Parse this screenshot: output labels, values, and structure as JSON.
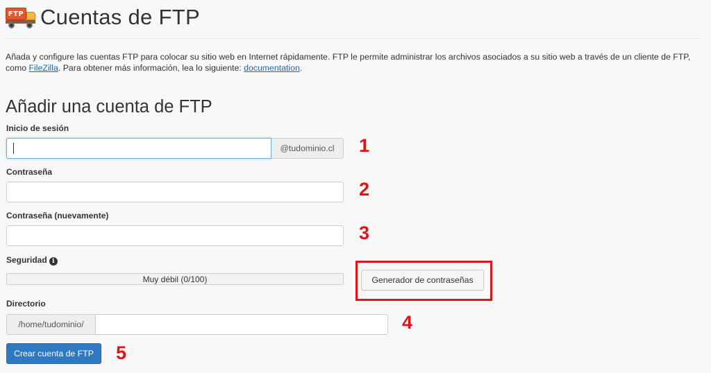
{
  "header": {
    "icon_text": "FTP",
    "title": "Cuentas de FTP"
  },
  "description": {
    "text_1": "Añada y configure las cuentas FTP para colocar su sitio web en Internet rápidamente. FTP le permite administrar los archivos asociados a su sitio web a través de un cliente de FTP, como ",
    "link_filezilla": "FileZilla",
    "text_2": ". Para obtener más información, lea lo siguiente: ",
    "link_documentation": "documentation",
    "text_3": "."
  },
  "form": {
    "section_title": "Añadir una cuenta de FTP",
    "login": {
      "label": "Inicio de sesión",
      "value": "",
      "domain_suffix": "@tudominio.cl"
    },
    "password": {
      "label": "Contraseña",
      "value": ""
    },
    "password_again": {
      "label": "Contraseña (nuevamente)",
      "value": ""
    },
    "security": {
      "label": "Seguridad",
      "info_icon": "i",
      "strength_text": "Muy débil (0/100)",
      "strength_value": 0,
      "strength_max": 100,
      "generator_button": "Generador de contraseñas"
    },
    "directory": {
      "label": "Directorio",
      "prefix": "/home/tudominio/",
      "value": ""
    },
    "submit_button": "Crear cuenta de FTP"
  },
  "annotations": {
    "step_1": "1",
    "step_2": "2",
    "step_3": "3",
    "step_4": "4",
    "step_5": "5",
    "highlight_color": "#e0121b"
  },
  "colors": {
    "primary_button": "#2f79c2",
    "link": "#1a6ab0",
    "focus_border": "#66afe9"
  }
}
